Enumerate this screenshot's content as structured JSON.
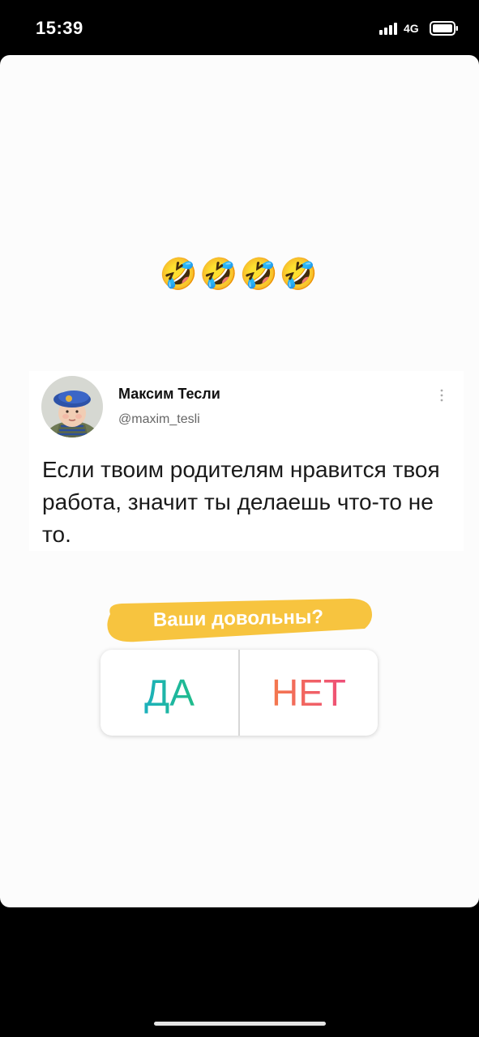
{
  "status_bar": {
    "time": "15:39",
    "network": "4G",
    "signal_icon": "signal-bars-icon",
    "battery_icon": "battery-icon"
  },
  "story": {
    "emojis": "🤣🤣🤣🤣",
    "tweet": {
      "author_name": "Максим Тесли",
      "author_handle": "@maxim_tesli",
      "text": "Если твоим родителям нравится твоя работа, значит ты делаешь что-то не то."
    },
    "poll": {
      "question": "Ваши довольны?",
      "options": [
        "ДА",
        "НЕТ"
      ]
    }
  },
  "colors": {
    "highlight": "#f7c43f",
    "yes_gradient": [
      "#1aa7e8",
      "#22c55e"
    ],
    "no_gradient": [
      "#f68b3a",
      "#ec3c8c"
    ]
  }
}
